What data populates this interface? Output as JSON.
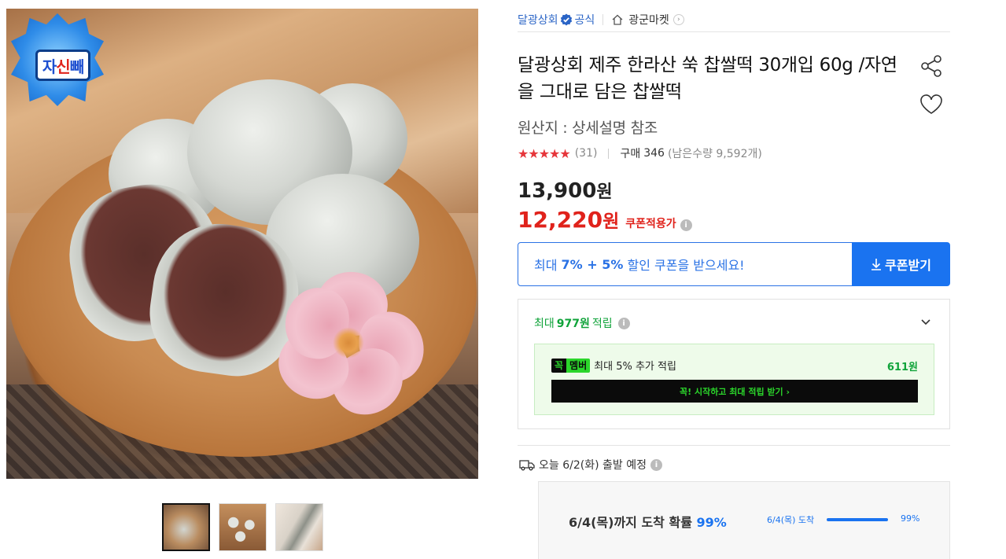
{
  "seller": {
    "name": "달광상회",
    "official": "공식",
    "market": "광군마켓"
  },
  "product": {
    "title": "달광상회 제주 한라산 쑥 찹쌀떡 30개입 60g /자연을 그대로 담은 찹쌀떡",
    "origin": "원산지 : 상세설명 참조",
    "rating_stars": "★★★★★",
    "review_count": "(31)",
    "buy_label": "구매",
    "buy_count": "346",
    "stock": "(남은수량 9,592개)"
  },
  "badge": {
    "text_a": "자",
    "text_b": "신",
    "text_c": "빼"
  },
  "price": {
    "original": "13,900",
    "sale": "12,220",
    "unit": "원",
    "coupon_tag": "쿠폰적용가"
  },
  "coupon": {
    "prefix": "최대",
    "rates": "7% + 5%",
    "suffix": "할인 쿠폰을 받으세요!",
    "button": "쿠폰받기"
  },
  "reward": {
    "prefix": "최대",
    "amount": "977원",
    "suffix": "적립",
    "member_badge_a": "꼭",
    "member_badge_b": "멤버",
    "member_text": "최대 5% 추가 적립",
    "member_amount": "611원",
    "member_cta": "꼭! 시작하고 최대 적립 받기 ›"
  },
  "shipping": {
    "text": "오늘 6/2(화) 출발 예정"
  },
  "delivery": {
    "main": "6/4(목)까지 도착 확률",
    "main_pct": "99%",
    "small_label": "6/4(목) 도착",
    "bar_pct": "99%",
    "bar_fill": 0.99
  },
  "thumbnails": [
    "thumb-1",
    "thumb-2",
    "thumb-3"
  ],
  "colors": {
    "brand_blue": "#1a73f0",
    "sale_red": "#e0221b",
    "reward_green": "#10a33a"
  }
}
